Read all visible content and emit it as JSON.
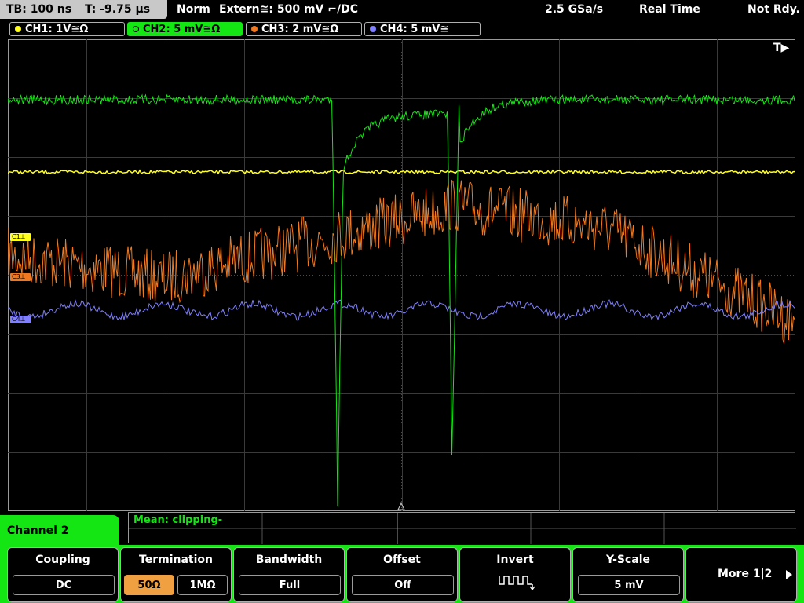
{
  "statusbar": {
    "timebase": "TB: 100 ns",
    "trigger_time": "T: -9.75 µs",
    "trigger_mode": "Norm",
    "trigger_source": "Extern≅: 500 mV ⌐/DC",
    "sample_rate": "2.5 GSa/s",
    "acq_mode": "Real Time",
    "state": "Not Rdy."
  },
  "channels": [
    {
      "label": "CH1: 1V≅Ω",
      "color": "#ffff20"
    },
    {
      "label": "CH2: 5 mV≅Ω",
      "color": "#14e614"
    },
    {
      "label": "CH3: 2 mV≅Ω",
      "color": "#f07820"
    },
    {
      "label": "CH4: 5 mV≅",
      "color": "#8080ff"
    }
  ],
  "screen": {
    "trigger_marker": "T▶",
    "markers": [
      {
        "label": "C1⊥",
        "color": "#ffff20"
      },
      {
        "label": "C3⊥",
        "color": "#f07820"
      },
      {
        "label": "C4⊥",
        "color": "#8080ff"
      }
    ]
  },
  "measurement": {
    "text": "Mean: clipping-"
  },
  "menu": {
    "title": "Channel 2",
    "coupling": {
      "title": "Coupling",
      "value": "DC"
    },
    "termination": {
      "title": "Termination",
      "opt1": "50Ω",
      "opt2": "1MΩ"
    },
    "bandwidth": {
      "title": "Bandwidth",
      "value": "Full"
    },
    "offset": {
      "title": "Offset",
      "value": "Off"
    },
    "invert": {
      "title": "Invert",
      "icon": "inverted-square-wave-icon"
    },
    "yscale": {
      "title": "Y-Scale",
      "value": "5 mV"
    },
    "more": {
      "label": "More 1|2",
      "icon": "arrow-right-icon"
    }
  }
}
